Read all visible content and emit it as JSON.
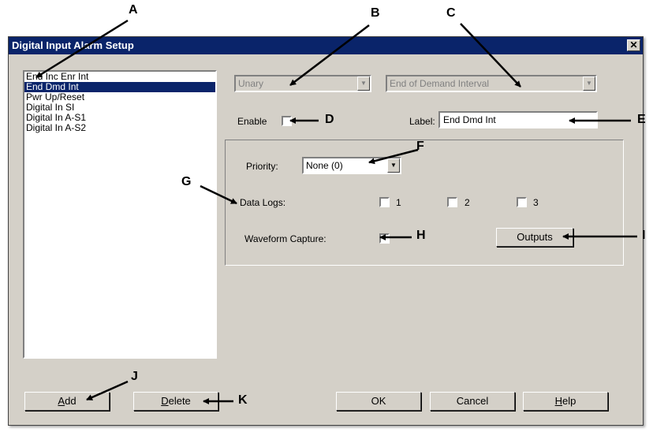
{
  "callouts": {
    "a": "A",
    "b": "B",
    "c": "C",
    "d": "D",
    "e": "E",
    "f": "F",
    "g": "G",
    "h": "H",
    "i": "I",
    "j": "J",
    "k": "K"
  },
  "dialog": {
    "title": "Digital Input Alarm Setup",
    "close_glyph": "✕",
    "alarm_list": [
      "End Inc Enr Int",
      "End Dmd Int",
      "Pwr Up/Reset",
      "Digital In SI",
      "Digital In A-S1",
      "Digital In A-S2"
    ],
    "selected_index": 1,
    "type_combo": "Unary",
    "event_combo": "End of Demand Interval",
    "enable_label": "Enable",
    "label_caption": "Label:",
    "label_value": "End Dmd Int",
    "priority_label": "Priority:",
    "priority_value": "None (0)",
    "data_logs_label": "Data Logs:",
    "log_1": "1",
    "log_2": "2",
    "log_3": "3",
    "waveform_label": "Waveform Capture:",
    "outputs_button": "Outputs",
    "add_button": {
      "pre": "",
      "ul": "A",
      "post": "dd"
    },
    "delete_button": {
      "pre": "",
      "ul": "D",
      "post": "elete"
    },
    "ok_button": "OK",
    "cancel_button": "Cancel",
    "help_button": {
      "pre": "",
      "ul": "H",
      "post": "elp"
    },
    "combo_arrow_glyph": "▼"
  }
}
